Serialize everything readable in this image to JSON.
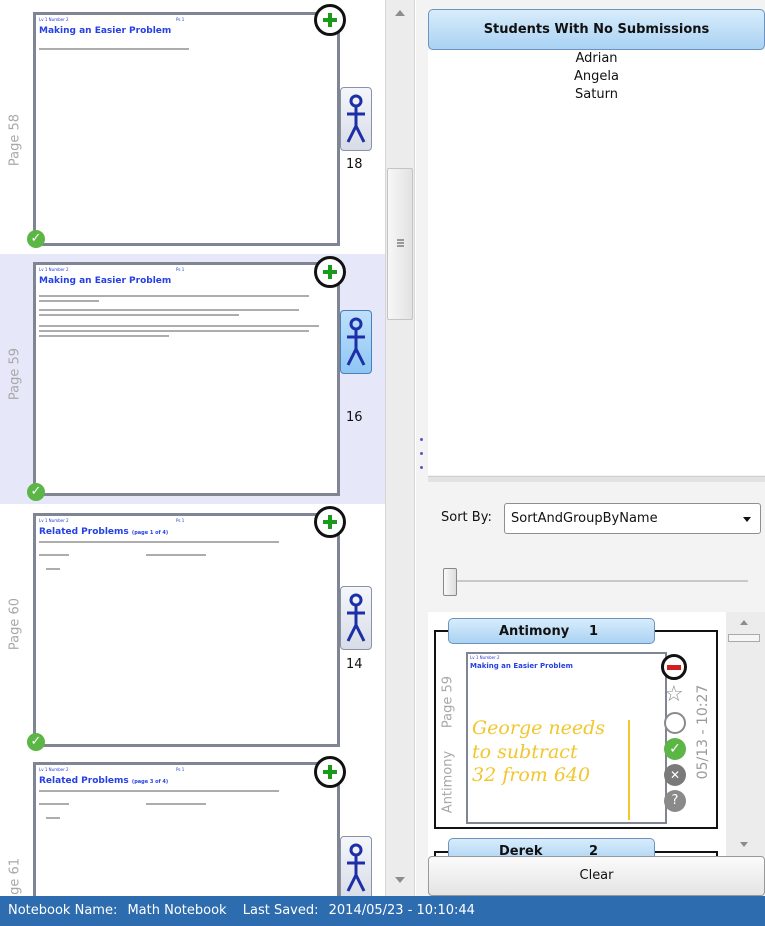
{
  "pages": [
    {
      "label": "Page 58",
      "header_left": "Lv 1 Number 2",
      "header_right": "Ps 1",
      "title": "Making an Easier Problem",
      "title_small": "",
      "count": "18"
    },
    {
      "label": "Page 59",
      "header_left": "Lv 1 Number 2",
      "header_right": "Ps 1",
      "title": "Making an Easier Problem",
      "title_small": "",
      "count": "16"
    },
    {
      "label": "Page 60",
      "header_left": "Lv 1 Number 2",
      "header_right": "Ps 1",
      "title": "Related Problems",
      "title_small": "(page 1 of 4)",
      "count": "14"
    },
    {
      "label": "Page 61",
      "header_left": "Lv 1 Number 2",
      "header_right": "Ps 1",
      "title": "Related Problems",
      "title_small": "(page 3 of 4)",
      "count": ""
    }
  ],
  "no_submissions": {
    "header": "Students With No Submissions",
    "students": [
      "Adrian",
      "Angela",
      "Saturn"
    ]
  },
  "sort": {
    "label": "Sort By:",
    "selected": "SortAndGroupByName"
  },
  "groups": [
    {
      "name": "Antimony",
      "count": "1",
      "submission": {
        "student": "Antimony",
        "page": "Page 59",
        "timestamp": "05/13 - 10:27",
        "title": "Making an Easier Problem",
        "handwriting": [
          "George needs",
          "to subtract",
          "32 from 640"
        ]
      }
    },
    {
      "name": "Derek",
      "count": "2"
    }
  ],
  "clear_label": "Clear",
  "status": {
    "notebook_label": "Notebook Name:",
    "notebook_name": "Math Notebook",
    "saved_label": "Last Saved:",
    "saved_value": "2014/05/23 - 10:10:44"
  },
  "colors": {
    "accent": "#2e6cb0",
    "check": "#5cb645",
    "plus": "#1a9a1a",
    "title_blue": "#2540e3",
    "selected_row": "#e6e8fa"
  },
  "icons": {
    "add": "add-submission-icon",
    "person": "student-icon",
    "check": "check-icon"
  }
}
